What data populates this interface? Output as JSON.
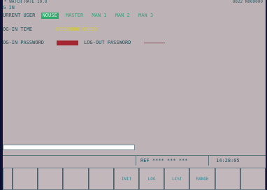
{
  "header": {
    "left_text": "* WATCH RATE 19.0",
    "right_text": "0022 N000000"
  },
  "screen_title": "G IN",
  "current_user": {
    "label": "URRENT USER",
    "options": [
      "NOUSE",
      "MASTER",
      "MAN 1",
      "MAN 2",
      "MAN 3"
    ],
    "selected": "NOUSE"
  },
  "login_time": {
    "label": "OG-IN TIME",
    "value": "00000000 00000"
  },
  "login_password": {
    "label": "OG-IN PASSWORD"
  },
  "logout_password": {
    "label": "LOG-OUT PASSWORD"
  },
  "progress": {
    "fraction": 1.0
  },
  "status": {
    "ref": "REF **** *** ***",
    "time": "14:28:05"
  },
  "softkeys": [
    "",
    "",
    "",
    "",
    "",
    "INIT",
    "LOG",
    "LIST",
    "RANGE",
    "",
    ""
  ],
  "colors": {
    "screen_bg": "#bdb3b6",
    "active_tag_bg": "#2fa96c",
    "password_box": "#a32630",
    "time_value": "#d9d01e"
  }
}
